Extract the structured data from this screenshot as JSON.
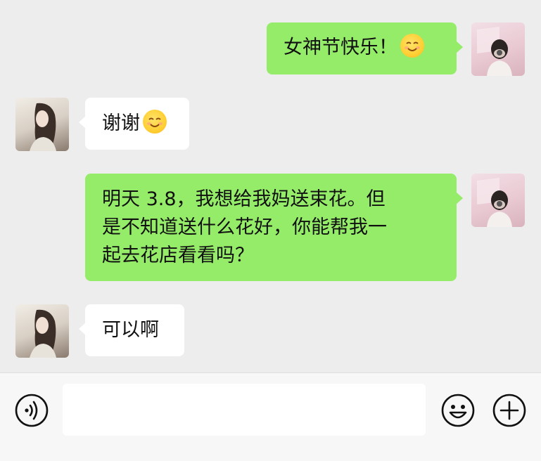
{
  "messages": [
    {
      "side": "out",
      "text": "女神节快乐！",
      "emoji": "smile-emoji"
    },
    {
      "side": "in",
      "text": "谢谢",
      "emoji": "smile-emoji"
    },
    {
      "side": "out",
      "lines": [
        "明天 3.8，我想给我妈送束花。但",
        "是不知道送什么花好，你能帮我一",
        "起去花店看看吗？"
      ]
    },
    {
      "side": "in",
      "text": "可以啊"
    }
  ],
  "input_bar": {
    "left_icon": "voice-icon",
    "right_icons": [
      "emoji-icon",
      "plus-icon"
    ],
    "text_value": ""
  },
  "colors": {
    "outgoing_bubble": "#95ec69",
    "incoming_bubble": "#ffffff",
    "background": "#ededed"
  }
}
